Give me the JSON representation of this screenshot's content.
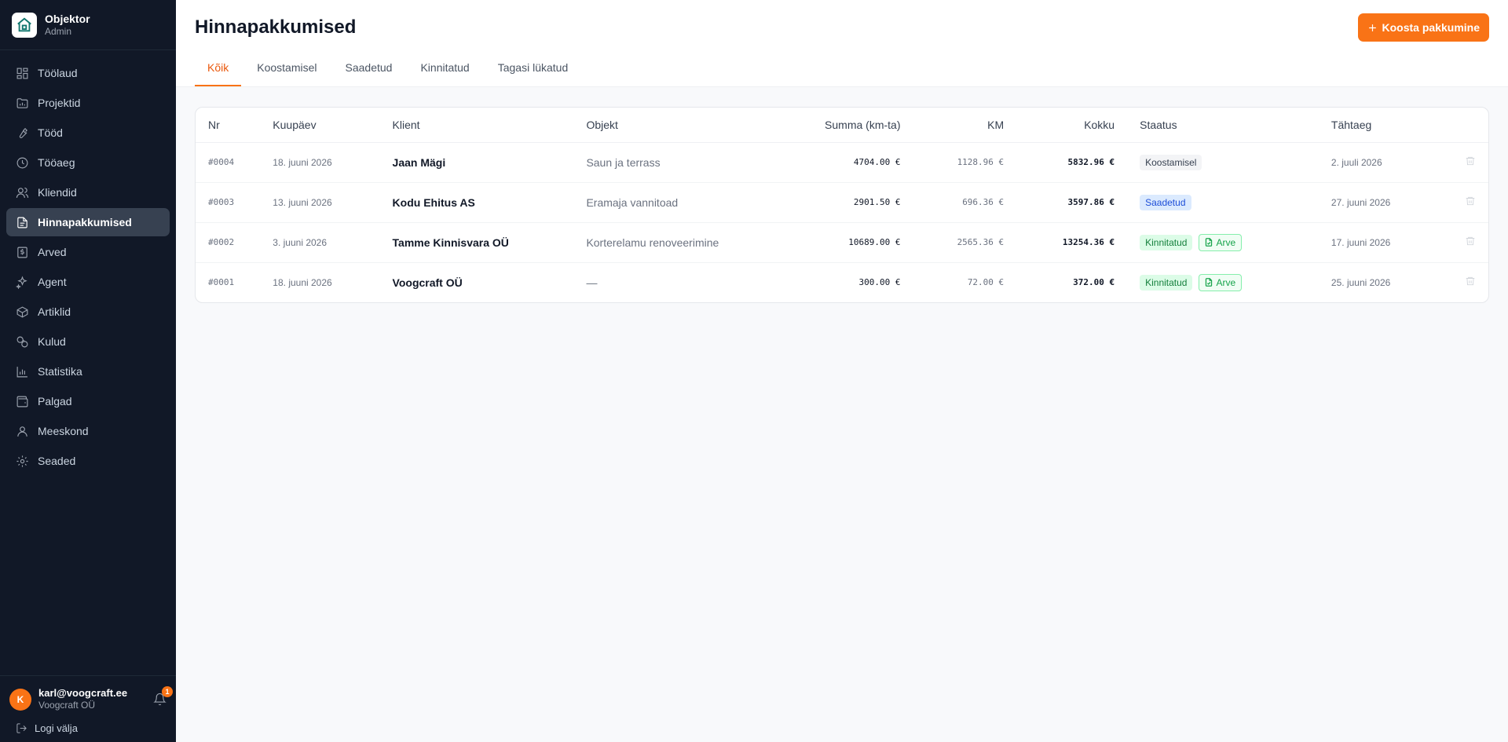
{
  "app": {
    "name": "Objektor",
    "role": "Admin"
  },
  "sidebar": {
    "items": [
      {
        "label": "Töölaud",
        "icon": "dashboard-icon"
      },
      {
        "label": "Projektid",
        "icon": "folder-icon"
      },
      {
        "label": "Tööd",
        "icon": "wrench-icon"
      },
      {
        "label": "Tööaeg",
        "icon": "clock-icon"
      },
      {
        "label": "Kliendid",
        "icon": "users-icon"
      },
      {
        "label": "Hinnapakkumised",
        "icon": "document-icon"
      },
      {
        "label": "Arved",
        "icon": "invoice-icon"
      },
      {
        "label": "Agent",
        "icon": "sparkles-icon"
      },
      {
        "label": "Artiklid",
        "icon": "box-icon"
      },
      {
        "label": "Kulud",
        "icon": "coins-icon"
      },
      {
        "label": "Statistika",
        "icon": "chart-icon"
      },
      {
        "label": "Palgad",
        "icon": "wallet-icon"
      },
      {
        "label": "Meeskond",
        "icon": "team-icon"
      },
      {
        "label": "Seaded",
        "icon": "gear-icon"
      }
    ],
    "active_index": 5
  },
  "user": {
    "initial": "K",
    "email": "karl@voogcraft.ee",
    "company": "Voogcraft OÜ",
    "notifications": "1",
    "logout_label": "Logi välja"
  },
  "header": {
    "title": "Hinnapakkumised",
    "new_button_label": "Koosta pakkumine"
  },
  "tabs": [
    {
      "label": "Kõik",
      "active": true
    },
    {
      "label": "Koostamisel",
      "active": false
    },
    {
      "label": "Saadetud",
      "active": false
    },
    {
      "label": "Kinnitatud",
      "active": false
    },
    {
      "label": "Tagasi lükatud",
      "active": false
    }
  ],
  "table": {
    "columns": [
      "Nr",
      "Kuupäev",
      "Klient",
      "Objekt",
      "Summa (km-ta)",
      "KM",
      "Kokku",
      "Staatus",
      "Tähtaeg"
    ],
    "rows": [
      {
        "nr": "#0004",
        "date": "18. juuni 2026",
        "client": "Jaan Mägi",
        "object": "Saun ja terrass",
        "sum": "4704.00 €",
        "vat": "1128.96 €",
        "total": "5832.96 €",
        "status": "Koostamisel",
        "status_type": "draft",
        "invoice": "",
        "due": "2. juuli 2026"
      },
      {
        "nr": "#0003",
        "date": "13. juuni 2026",
        "client": "Kodu Ehitus AS",
        "object": "Eramaja vannitoad",
        "sum": "2901.50 €",
        "vat": "696.36 €",
        "total": "3597.86 €",
        "status": "Saadetud",
        "status_type": "sent",
        "invoice": "",
        "due": "27. juuni 2026"
      },
      {
        "nr": "#0002",
        "date": "3. juuni 2026",
        "client": "Tamme Kinnisvara OÜ",
        "object": "Korterelamu renoveerimine",
        "sum": "10689.00 €",
        "vat": "2565.36 €",
        "total": "13254.36 €",
        "status": "Kinnitatud",
        "status_type": "ok",
        "invoice": "Arve",
        "due": "17. juuni 2026"
      },
      {
        "nr": "#0001",
        "date": "18. juuni 2026",
        "client": "Voogcraft OÜ",
        "object": "—",
        "sum": "300.00 €",
        "vat": "72.00 €",
        "total": "372.00 €",
        "status": "Kinnitatud",
        "status_type": "ok",
        "invoice": "Arve",
        "due": "25. juuni 2026"
      }
    ]
  },
  "colors": {
    "accent": "#f97316",
    "sidebar_bg": "#111827",
    "active_item_bg": "#374151"
  }
}
